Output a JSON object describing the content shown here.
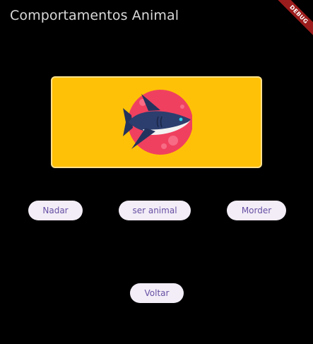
{
  "app": {
    "title": "Comportamentos Animal",
    "debug_banner": "DEBUG"
  },
  "card": {
    "illustration": "shark-icon",
    "background_color": "#ffc107",
    "circle_color": "#f0405f"
  },
  "actions": {
    "nadar_label": "Nadar",
    "ser_animal_label": "ser animal",
    "morder_label": "Morder"
  },
  "navigation": {
    "voltar_label": "Voltar"
  },
  "colors": {
    "background": "#000000",
    "button_bg": "#f3edf7",
    "button_text": "#6750a4",
    "debug_ribbon": "#9b1c1c"
  }
}
